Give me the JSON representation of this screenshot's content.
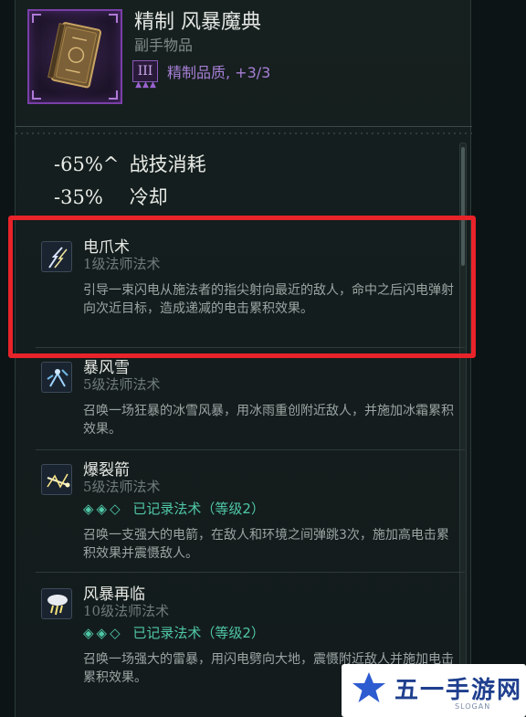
{
  "item": {
    "title": "精制 风暴魔典",
    "type": "副手物品",
    "quality_numeral": "III",
    "quality_text": "精制品质, +3/3"
  },
  "stats": [
    {
      "value": "-65%^",
      "label": "战技消耗"
    },
    {
      "value": "-35%",
      "label": "冷却"
    }
  ],
  "spells": [
    {
      "name": "电爪术",
      "level": "1级法师法术",
      "rank": null,
      "desc": "引导一束闪电从施法者的指尖射向最近的敌人，命中之后闪电弹射向次近目标，造成递减的电击累积效果。",
      "icon": "lightning-claw-icon"
    },
    {
      "name": "暴风雪",
      "level": "5级法师法术",
      "rank": null,
      "desc": "召唤一场狂暴的冰雪风暴，用冰雨重创附近敌人，并施加冰霜累积效果。",
      "icon": "blizzard-icon"
    },
    {
      "name": "爆裂箭",
      "level": "5级法师法术",
      "rank": {
        "gems": "◈◈◇",
        "text": "已记录法术（等级2）"
      },
      "desc": "召唤一支强大的电箭，在敌人和环境之间弹跳3次，施加高电击累积效果并震慑敌人。",
      "icon": "burst-arrow-icon"
    },
    {
      "name": "风暴再临",
      "level": "10级法师法术",
      "rank": {
        "gems": "◈◈◇",
        "text": "已记录法术（等级2）"
      },
      "desc": "召唤一场强大的雷暴，用闪电劈向大地，震慑附近敌人并施加电击累积效果。",
      "icon": "storm-cloud-icon"
    }
  ],
  "watermark": {
    "text": "五一手游网",
    "sub": "SLOGAN"
  },
  "colors": {
    "accent_purple": "#7a3fa8",
    "rank_green": "#4fc7a7",
    "highlight_red": "#e8232a"
  }
}
